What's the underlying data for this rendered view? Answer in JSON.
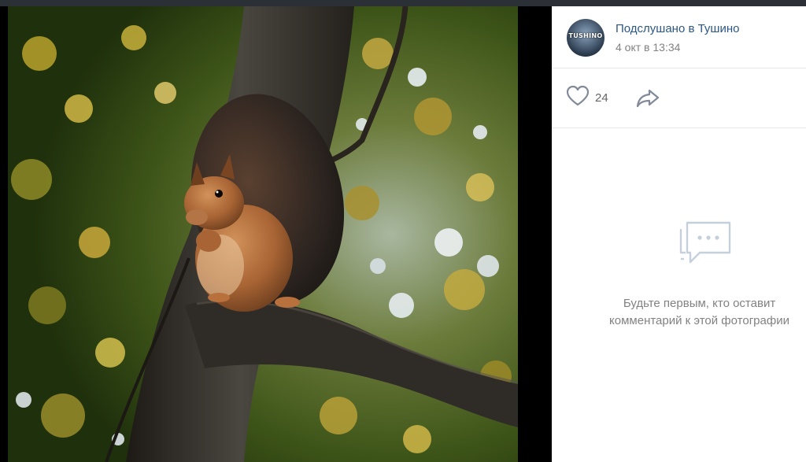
{
  "post": {
    "author_name": "Подслушано в Тушино",
    "avatar_text": "TUSHINO",
    "date": "4 окт в 13:34"
  },
  "actions": {
    "likes_count": "24",
    "like_icon": "heart-icon",
    "share_icon": "share-arrow-icon"
  },
  "comments": {
    "empty_line1": "Будьте первым, кто оставит",
    "empty_line2": "комментарий к этой фотографии",
    "empty_icon": "chat-bubble-icon"
  },
  "colors": {
    "link": "#2a5885",
    "muted": "#828282",
    "icon": "#828a99"
  }
}
